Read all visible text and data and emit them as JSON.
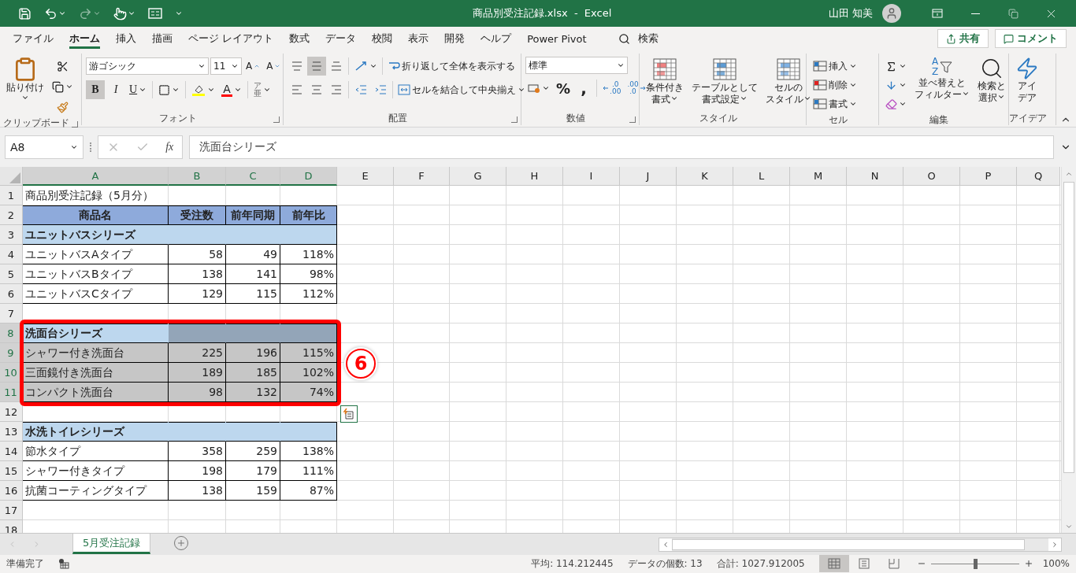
{
  "title_bar": {
    "title": "商品別受注記録.xlsx  -  Excel",
    "user": "山田 知美"
  },
  "menu_tabs": [
    {
      "label": "ファイル",
      "selected": false
    },
    {
      "label": "ホーム",
      "selected": true
    },
    {
      "label": "挿入",
      "selected": false
    },
    {
      "label": "描画",
      "selected": false
    },
    {
      "label": "ページ レイアウト",
      "selected": false
    },
    {
      "label": "数式",
      "selected": false
    },
    {
      "label": "データ",
      "selected": false
    },
    {
      "label": "校閲",
      "selected": false
    },
    {
      "label": "表示",
      "selected": false
    },
    {
      "label": "開発",
      "selected": false
    },
    {
      "label": "ヘルプ",
      "selected": false
    },
    {
      "label": "Power Pivot",
      "selected": false
    }
  ],
  "search": {
    "label": "検索"
  },
  "share_button": "共有",
  "comment_button": "コメント",
  "ribbon": [
    {
      "kind": "clipboard",
      "title": "クリップボード",
      "paste": "貼り付け"
    },
    {
      "kind": "font",
      "title": "フォント",
      "font_name": "游ゴシック",
      "font_size": "11",
      "grow_label": "A",
      "shrink_label": "A",
      "bold": true,
      "bold_label": "B",
      "italic_label": "I",
      "underline_label": "U",
      "font_color_label": "A",
      "phonetic_top": "ア",
      "phonetic_bottom": "亜"
    },
    {
      "kind": "alignment",
      "title": "配置",
      "middle_align": true,
      "wrap": "折り返して全体を表示する",
      "merge": "セルを結合して中央揃え"
    },
    {
      "kind": "number",
      "title": "数値",
      "format": "標準",
      "percent": "%",
      "comma": ",",
      "decimal_increase": [
        ".0",
        ".00"
      ],
      "decimal_decrease": [
        ".00",
        ".0"
      ]
    },
    {
      "kind": "styles",
      "title": "スタイル",
      "buttons": [
        [
          "条件付き",
          "書式"
        ],
        [
          "テーブルとして",
          "書式設定"
        ],
        [
          "セルの",
          "スタイル"
        ]
      ]
    },
    {
      "kind": "cells",
      "title": "セル",
      "buttons": [
        "挿入",
        "削除",
        "書式"
      ]
    },
    {
      "kind": "editing",
      "title": "編集",
      "sort_letters": [
        "A",
        "Z"
      ],
      "buttons": [
        [
          "並べ替えと",
          "フィルター"
        ],
        [
          "検索と",
          "選択"
        ]
      ]
    },
    {
      "kind": "ideas",
      "title": "アイデア",
      "button": [
        "アイ",
        "デア"
      ]
    }
  ],
  "formula_bar": {
    "name_box": "A8",
    "fx": "fx",
    "formula": "洗面台シリーズ"
  },
  "columns": [
    {
      "label": "A",
      "selected": true
    },
    {
      "label": "B",
      "selected": true
    },
    {
      "label": "C",
      "selected": true
    },
    {
      "label": "D",
      "selected": true
    },
    {
      "label": "E",
      "selected": false
    },
    {
      "label": "F",
      "selected": false
    },
    {
      "label": "G",
      "selected": false
    },
    {
      "label": "H",
      "selected": false
    },
    {
      "label": "I",
      "selected": false
    },
    {
      "label": "J",
      "selected": false
    },
    {
      "label": "K",
      "selected": false
    },
    {
      "label": "L",
      "selected": false
    },
    {
      "label": "M",
      "selected": false
    },
    {
      "label": "N",
      "selected": false
    },
    {
      "label": "O",
      "selected": false
    },
    {
      "label": "P",
      "selected": false
    },
    {
      "label": "Q",
      "selected": false
    }
  ],
  "rows": [
    {
      "number": "1",
      "kind": "title",
      "selected": false,
      "active": false,
      "cells": [
        "商品別受注記録（5月分）"
      ]
    },
    {
      "number": "2",
      "kind": "header",
      "selected": false,
      "active": false,
      "cells": [
        "商品名",
        "受注数",
        "前年同期",
        "前年比"
      ]
    },
    {
      "number": "3",
      "kind": "group",
      "selected": false,
      "active": false,
      "cells": [
        "ユニットバスシリーズ"
      ]
    },
    {
      "number": "4",
      "kind": "item",
      "selected": false,
      "active": false,
      "cells": [
        "ユニットバスAタイプ",
        "58",
        "49",
        "118%"
      ]
    },
    {
      "number": "5",
      "kind": "item",
      "selected": false,
      "active": false,
      "cells": [
        "ユニットバスBタイプ",
        "138",
        "141",
        "98%"
      ]
    },
    {
      "number": "6",
      "kind": "item",
      "selected": false,
      "active": false,
      "cells": [
        "ユニットバスCタイプ",
        "129",
        "115",
        "112%"
      ]
    },
    {
      "number": "7",
      "kind": "blank",
      "selected": false,
      "active": false
    },
    {
      "number": "8",
      "kind": "group",
      "selected": true,
      "active": true,
      "cells": [
        "洗面台シリーズ"
      ]
    },
    {
      "number": "9",
      "kind": "item",
      "selected": true,
      "active": false,
      "cells": [
        "シャワー付き洗面台",
        "225",
        "196",
        "115%"
      ]
    },
    {
      "number": "10",
      "kind": "item",
      "selected": true,
      "active": false,
      "cells": [
        "三面鏡付き洗面台",
        "189",
        "185",
        "102%"
      ]
    },
    {
      "number": "11",
      "kind": "item",
      "selected": true,
      "active": false,
      "cells": [
        "コンパクト洗面台",
        "98",
        "132",
        "74%"
      ]
    },
    {
      "number": "12",
      "kind": "blank",
      "selected": false,
      "active": false
    },
    {
      "number": "13",
      "kind": "group",
      "selected": false,
      "active": false,
      "cells": [
        "水洗トイレシリーズ"
      ]
    },
    {
      "number": "14",
      "kind": "item",
      "selected": false,
      "active": false,
      "cells": [
        "節水タイプ",
        "358",
        "259",
        "138%"
      ]
    },
    {
      "number": "15",
      "kind": "item",
      "selected": false,
      "active": false,
      "cells": [
        "シャワー付きタイプ",
        "198",
        "179",
        "111%"
      ]
    },
    {
      "number": "16",
      "kind": "item",
      "selected": false,
      "active": false,
      "cells": [
        "抗菌コーティングタイプ",
        "138",
        "159",
        "87%"
      ]
    },
    {
      "number": "17",
      "kind": "blank",
      "selected": false,
      "active": false
    },
    {
      "number": "18",
      "kind": "blank",
      "selected": false,
      "active": false
    }
  ],
  "annotation": {
    "label": "6"
  },
  "sheet_tabs": [
    {
      "label": "5月受注記録",
      "selected": true
    }
  ],
  "status_bar": {
    "state": "準備完了",
    "stats": [
      "平均: 114.212445",
      "データの個数: 13",
      "合計: 1027.912005"
    ],
    "views": [
      {
        "kind": "normal",
        "selected": true
      },
      {
        "kind": "page_layout",
        "selected": false
      },
      {
        "kind": "page_break",
        "selected": false
      }
    ],
    "zoom": {
      "level": 0.5,
      "reading": "100%"
    }
  }
}
